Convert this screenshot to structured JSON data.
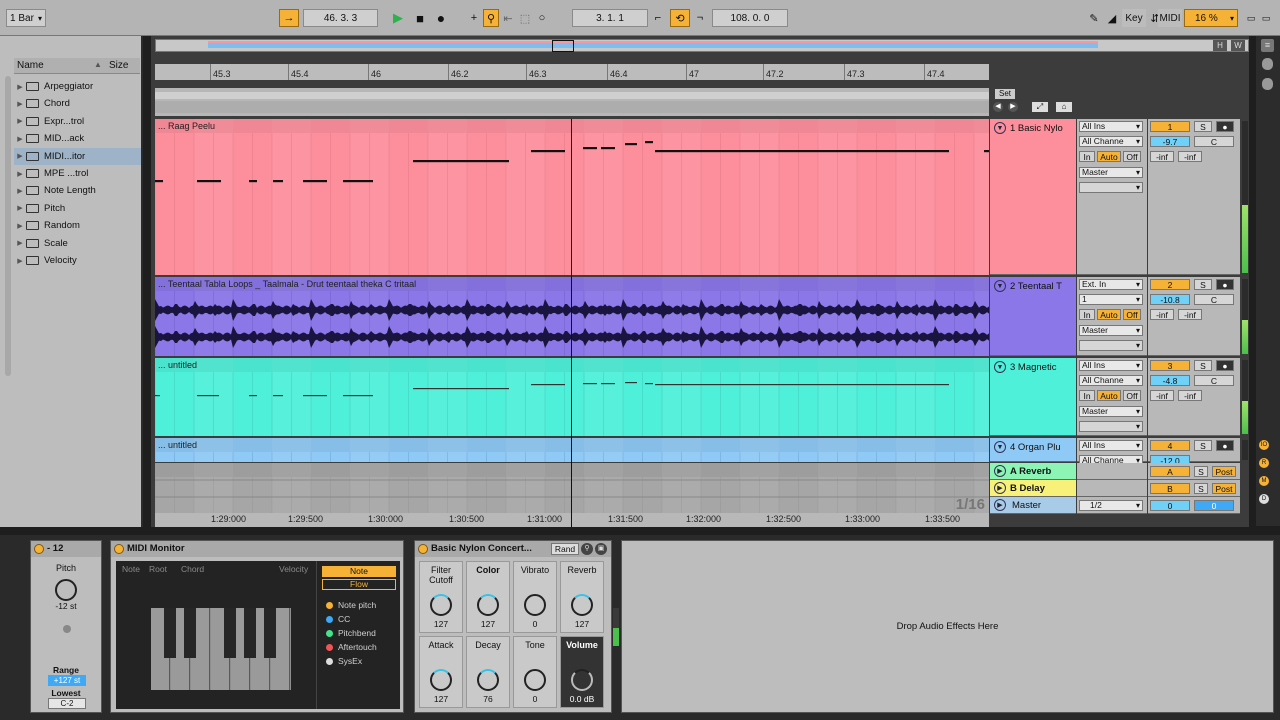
{
  "transport": {
    "quantize": "1 Bar",
    "position": "46.   3.   3",
    "loop_start": "3.   1.   1",
    "loop_length": "108.   0.   0",
    "key_label": "Key",
    "midi_label": "MIDI",
    "zoom": "16 %"
  },
  "browser": {
    "col_name": "Name",
    "col_size": "Size",
    "items": [
      {
        "label": "Arpeggiator",
        "expanded": false
      },
      {
        "label": "Chord",
        "expanded": false
      },
      {
        "label": "Expr...trol",
        "expanded": false
      },
      {
        "label": "MID...ack",
        "expanded": false
      },
      {
        "label": "MIDI...itor",
        "expanded": false,
        "selected": true
      },
      {
        "label": "MPE ...trol",
        "expanded": false
      },
      {
        "label": "Note Length",
        "expanded": false
      },
      {
        "label": "Pitch",
        "expanded": false
      },
      {
        "label": "Random",
        "expanded": false
      },
      {
        "label": "Scale",
        "expanded": false
      },
      {
        "label": "Velocity",
        "expanded": false
      }
    ]
  },
  "arrangement": {
    "overview_buttons": [
      "H",
      "W"
    ],
    "bar_ticks": [
      "45.3",
      "45.4",
      "46",
      "46.2",
      "46.3",
      "46.4",
      "47",
      "47.2",
      "47.3",
      "47.4"
    ],
    "time_ticks": [
      "1:29:000",
      "1:29:500",
      "1:30:000",
      "1:30:500",
      "1:31:000",
      "1:31:500",
      "1:32:000",
      "1:32:500",
      "1:33:000",
      "1:33:500"
    ],
    "set_label": "Set",
    "grid_label": "1/16"
  },
  "tracks": [
    {
      "clip_title": "... Raag Peelu",
      "name": "1 Basic Nylo",
      "input_type": "All Ins",
      "input_channel": "All Channe",
      "monitor": [
        "In",
        "Auto",
        "Off"
      ],
      "output": "Master",
      "number": "1",
      "volume": "-9.7",
      "pan": "C",
      "peak_l": "-inf",
      "peak_r": "-inf",
      "color": "#fd8f9c"
    },
    {
      "clip_title": "... Teentaal Tabla Loops _ Taalmala - Drut teentaal theka C tritaal",
      "name": "2 Teentaal T",
      "input_type": "Ext. In",
      "input_channel": "1",
      "monitor": [
        "In",
        "Auto",
        "Off"
      ],
      "output": "Master",
      "number": "2",
      "volume": "-10.8",
      "pan": "C",
      "peak_l": "-inf",
      "peak_r": "-inf",
      "color": "#8b77e8"
    },
    {
      "clip_title": "... untitled",
      "name": "3 Magnetic",
      "input_type": "All Ins",
      "input_channel": "All Channe",
      "monitor": [
        "In",
        "Auto",
        "Off"
      ],
      "output": "Master",
      "number": "3",
      "volume": "-4.8",
      "pan": "C",
      "peak_l": "-inf",
      "peak_r": "-inf",
      "color": "#4ff0d9"
    },
    {
      "clip_title": "... untitled",
      "name": "4 Organ Plu",
      "input_type": "All Ins",
      "input_channel": "All Channe",
      "number": "4",
      "volume": "-12.0",
      "color": "#8fc9f5"
    }
  ],
  "returns": [
    {
      "name": "A Reverb",
      "letter": "A",
      "solo": "S",
      "post": "Post",
      "color": "#8cf5b6"
    },
    {
      "name": "B Delay",
      "letter": "B",
      "solo": "S",
      "post": "Post",
      "color": "#f7f17a"
    }
  ],
  "master": {
    "name": "Master",
    "io": "1/2",
    "value_a": "0",
    "value_b": "0"
  },
  "solo_label": "S",
  "devices": {
    "pitch": {
      "title": "- 12",
      "knob_label": "Pitch",
      "knob_value": "-12 st",
      "range_label": "Range",
      "range_value": "+127 st",
      "lowest_label": "Lowest",
      "lowest_value": "C-2"
    },
    "monitor": {
      "title": "MIDI Monitor",
      "headers": [
        "Note",
        "Root",
        "Chord",
        "Velocity"
      ],
      "mode_buttons": [
        "Note",
        "Flow"
      ],
      "legend": [
        {
          "label": "Note pitch",
          "color": "#f6b236"
        },
        {
          "label": "CC",
          "color": "#3fa9f5"
        },
        {
          "label": "Pitchbend",
          "color": "#45e38b"
        },
        {
          "label": "Aftertouch",
          "color": "#f05555"
        },
        {
          "label": "SysEx",
          "color": "#dddddd"
        }
      ]
    },
    "instrument": {
      "title": "Basic Nylon Concert...",
      "rand_label": "Rand",
      "macros": [
        {
          "label": "Filter Cutoff",
          "value": "127"
        },
        {
          "label": "Color",
          "value": "127"
        },
        {
          "label": "Vibrato",
          "value": "0"
        },
        {
          "label": "Reverb",
          "value": "127"
        },
        {
          "label": "Attack",
          "value": "127"
        },
        {
          "label": "Decay",
          "value": "76"
        },
        {
          "label": "Tone",
          "value": "0"
        },
        {
          "label": "Volume",
          "value": "0.0 dB"
        }
      ]
    },
    "drop_hint": "Drop Audio Effects Here"
  }
}
